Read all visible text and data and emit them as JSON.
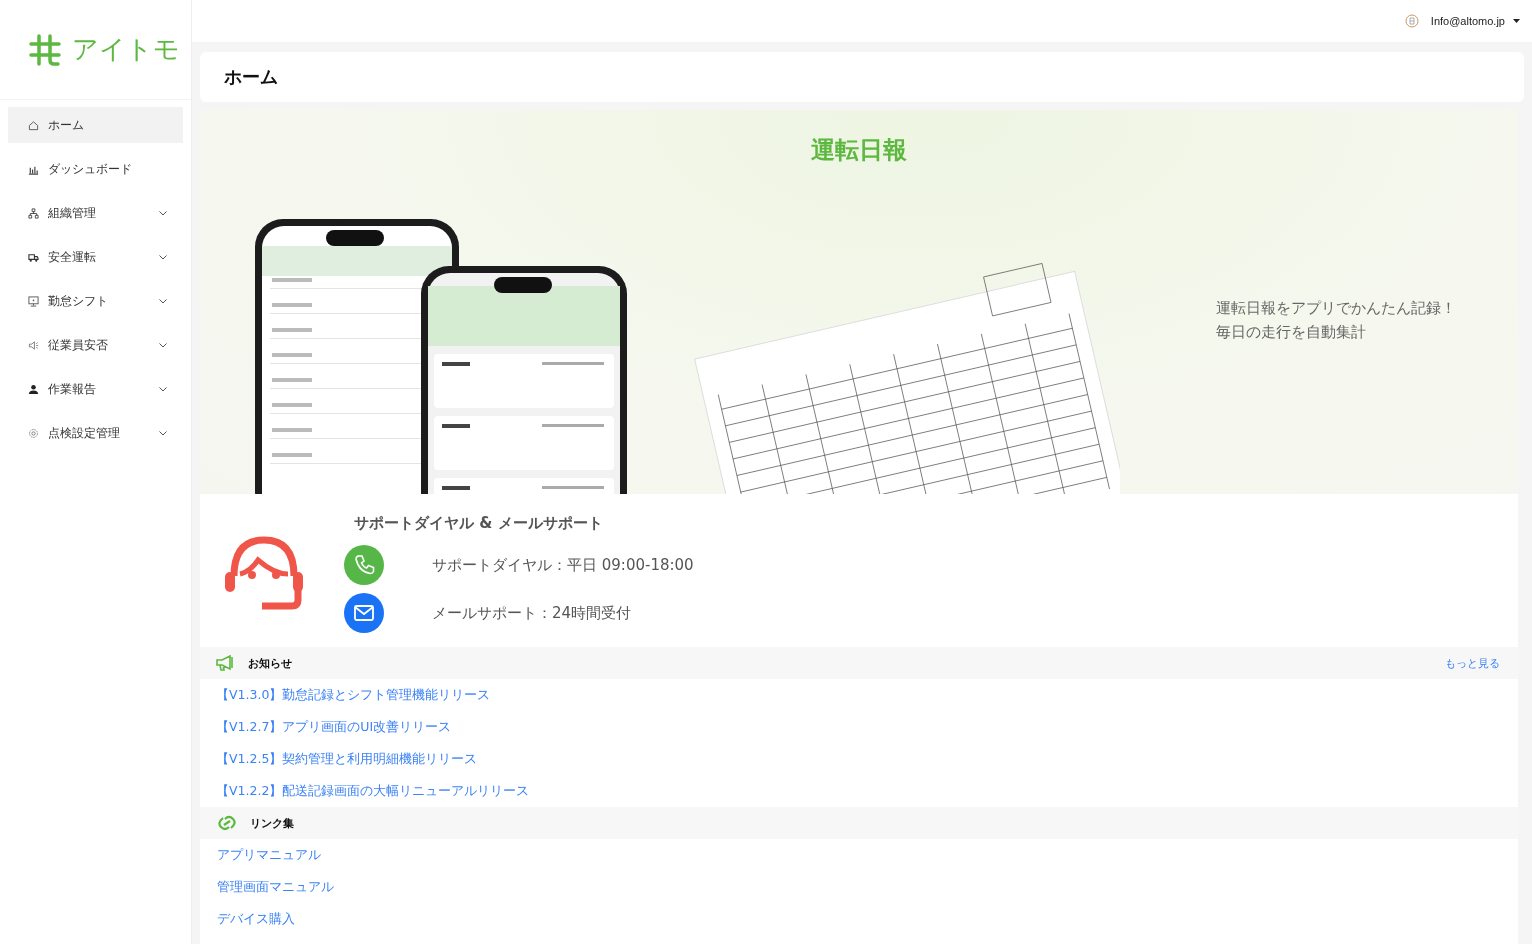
{
  "sidebar": {
    "logo": "アイトモ",
    "items": [
      {
        "label": "ホーム",
        "selected": true,
        "expandable": false
      },
      {
        "label": "ダッシュボード",
        "selected": false,
        "expandable": false
      },
      {
        "label": "組織管理",
        "selected": false,
        "expandable": true
      },
      {
        "label": "安全運転",
        "selected": false,
        "expandable": true
      },
      {
        "label": "勤怠シフト",
        "selected": false,
        "expandable": true
      },
      {
        "label": "従業員安否",
        "selected": false,
        "expandable": true
      },
      {
        "label": "作業報告",
        "selected": false,
        "expandable": true
      },
      {
        "label": "点検設定管理",
        "selected": false,
        "expandable": true
      }
    ]
  },
  "topbar": {
    "account": "Info@altomo.jp"
  },
  "page_title": "ホーム",
  "banner": {
    "title": "運転日報",
    "caption": [
      "運転日報をアプリでかんたん記録！",
      "毎日の走行を自動集計"
    ]
  },
  "support": {
    "title": "サポートダイヤル & メールサポート",
    "lines": [
      {
        "kind": "phone",
        "text": "サポートダイヤル：平日 09:00-18:00"
      },
      {
        "kind": "mail",
        "text": "メールサポート：24時間受付"
      }
    ]
  },
  "notices": {
    "title": "お知らせ",
    "more": "もっと見る",
    "items": [
      "【V1.3.0】勤怠記録とシフト管理機能リリース",
      "【V1.2.7】アプリ画面のUI改善リリース",
      "【V1.2.5】契約管理と利用明細機能リリース",
      "【V1.2.2】配送記録画面の大幅リニューアルリリース"
    ]
  },
  "links": {
    "title": "リンク集",
    "items": [
      "アプリマニュアル",
      "管理画面マニュアル",
      "デバイス購入"
    ]
  }
}
